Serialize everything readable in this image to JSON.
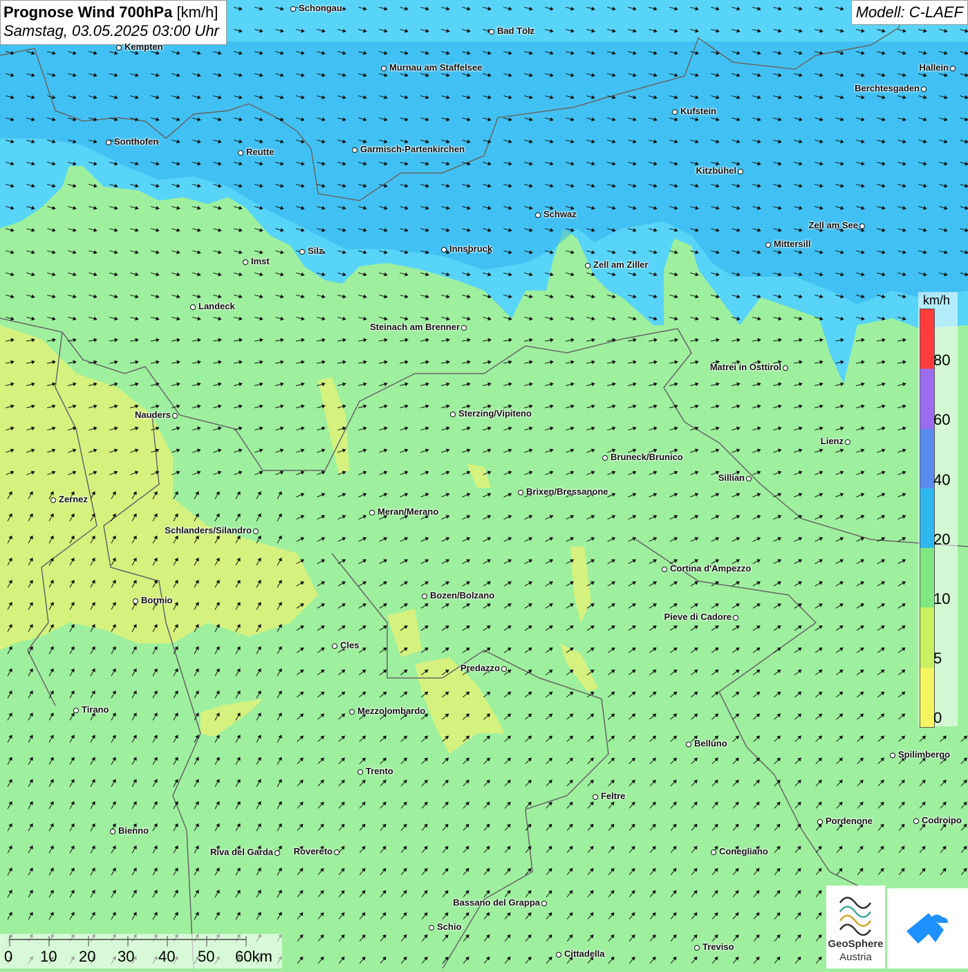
{
  "title": {
    "main": "Prognose Wind 700hPa",
    "unit": "[km/h]",
    "date": "Samstag, 03.05.2025 03:00 Uhr"
  },
  "model": "Modell: C-LAEF",
  "legend": {
    "unit": "km/h",
    "ticks": [
      "80",
      "60",
      "40",
      "20",
      "10",
      "5",
      "0"
    ],
    "colors": [
      "#ff3b3b",
      "#9b6bf0",
      "#5a8cf0",
      "#2fb8f0",
      "#80e880",
      "#c8f060",
      "#f5f560"
    ]
  },
  "scale": {
    "labels": [
      "0",
      "10",
      "20",
      "30",
      "40",
      "50",
      "60km"
    ]
  },
  "logo": {
    "line1": "GeoSphere",
    "line2": "Austria"
  },
  "cities": [
    {
      "name": "Schongau"
    },
    {
      "name": "Bad Tölz"
    },
    {
      "name": "Kempten"
    },
    {
      "name": "Murnau am Staffelsee"
    },
    {
      "name": "Hallein"
    },
    {
      "name": "Berchtesgaden"
    },
    {
      "name": "Kufstein"
    },
    {
      "name": "Sonthofen"
    },
    {
      "name": "Reutte"
    },
    {
      "name": "Garmisch-Partenkirchen"
    },
    {
      "name": "Kitzbühel"
    },
    {
      "name": "Schwaz"
    },
    {
      "name": "Zell am See"
    },
    {
      "name": "Mittersill"
    },
    {
      "name": "Innsbruck"
    },
    {
      "name": "Silz"
    },
    {
      "name": "Imst"
    },
    {
      "name": "Zell am Ziller"
    },
    {
      "name": "Landeck"
    },
    {
      "name": "Steinach am Brenner"
    },
    {
      "name": "Matrei in Osttirol"
    },
    {
      "name": "Nauders"
    },
    {
      "name": "Sterzing/Vipiteno"
    },
    {
      "name": "Lienz"
    },
    {
      "name": "Bruneck/Brunico"
    },
    {
      "name": "Sillian"
    },
    {
      "name": "Zernez"
    },
    {
      "name": "Brixen/Bressanone"
    },
    {
      "name": "Meran/Merano"
    },
    {
      "name": "Schlanders/Silandro"
    },
    {
      "name": "Cortina d'Ampezzo"
    },
    {
      "name": "Bozen/Bolzano"
    },
    {
      "name": "Bormio"
    },
    {
      "name": "Pieve di Cadore"
    },
    {
      "name": "Cles"
    },
    {
      "name": "Predazzo"
    },
    {
      "name": "Tirano"
    },
    {
      "name": "Mezzolombardo"
    },
    {
      "name": "Belluno"
    },
    {
      "name": "Spilimbergo"
    },
    {
      "name": "Trento"
    },
    {
      "name": "Feltre"
    },
    {
      "name": "Bienno"
    },
    {
      "name": "Pordenone"
    },
    {
      "name": "Codroipo"
    },
    {
      "name": "Riva del Garda"
    },
    {
      "name": "Rovereto"
    },
    {
      "name": "Conegliano"
    },
    {
      "name": "Bassano del Grappa"
    },
    {
      "name": "Schio"
    },
    {
      "name": "Treviso"
    },
    {
      "name": "Cittadella"
    }
  ]
}
